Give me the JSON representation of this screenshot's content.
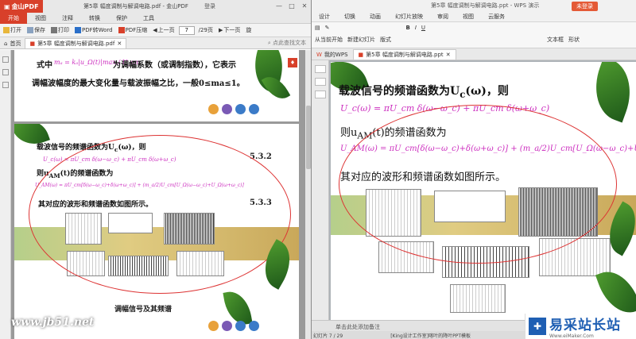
{
  "left_window": {
    "app_name": "金山PDF",
    "title": "第5章 幅度调制与解调电路.pdf - 金山PDF",
    "login": "登录",
    "menu": [
      "开始",
      "视图",
      "注释",
      "转换",
      "保护",
      "工具"
    ],
    "toolbar": {
      "open": "打开",
      "save": "保存",
      "print": "打印",
      "pdf_to_word": "PDF转Word",
      "pdf_compress": "PDF压缩",
      "prev_page": "上一页",
      "next_page": "下一页",
      "current_page": "7",
      "total_pages": "/29页",
      "rotate": "旋"
    },
    "tabs": {
      "home": "首页",
      "document": "第5章 幅度调制与解调电路.pdf"
    },
    "search_placeholder": "点此查找文本",
    "page1": {
      "line1_prefix": "式中",
      "line1_formula": "mₐ = kₐ|u_Ω(t)|max / U_cm",
      "line1_suffix": "为调幅系数（或调制指数），它表示",
      "line2": "调幅波幅度的最大变化量与载波振幅之比，一般0≤ma≤1。"
    },
    "page2": {
      "line1": "载波信号的频谱函数为U",
      "line1_sub": "c",
      "line1_tail": "(ω)，则",
      "formula1": "U_c(ω) = πU_cm δ(ω−ω_c) + πU_cm δ(ω+ω_c)",
      "eq1": "5.3.2",
      "line2_prefix": "则u",
      "line2_sub": "AM",
      "line2_tail": "(t)的频谱函数为",
      "formula2": "U_AM(ω) = πU_cm[δ(ω−ω_c)+δ(ω+ω_c)] + (m_a/2)U_cm[U_Ω(ω−ω_c)+U_Ω(ω+ω_c)]",
      "eq2": "5.3.3",
      "line3": "其对应的波形和频谱函数如图所示。",
      "figure_caption": "调幅信号及其频谱"
    },
    "watermark": "www.jb51.net"
  },
  "right_window": {
    "title": "第5章 幅度调制与解调电路.ppt - WPS 演示",
    "login_button": "未登录",
    "menu": [
      "设计",
      "切换",
      "动画",
      "幻灯片放映",
      "审阅",
      "视图",
      "云服务"
    ],
    "ribbon": {
      "from_current": "从当前开始",
      "new_slide": "新建幻灯片",
      "layout": "版式",
      "text_box": "文本框",
      "shape": "形状"
    },
    "tabs": {
      "my_wps": "我的WPS",
      "document": "第5章 幅度调制与解调电路.ppt"
    },
    "slide": {
      "line1": "载波信号的频谱函数为U",
      "line1_sub": "c",
      "line1_tail": "(ω)，则",
      "formula1": "U_c(ω) = πU_cm δ(ω−ω_c) + πU_cm δ(ω+ω_c)",
      "line2_prefix": "则u",
      "line2_sub": "AM",
      "line2_tail": "(t)的频谱函数为",
      "formula2": "U_AM(ω) = πU_cm[δ(ω−ω_c)+δ(ω+ω_c)] + (m_a/2)U_cm[U_Ω(ω−ω_c)+U",
      "line3": "其对应的波形和频谱函数如图所示。"
    },
    "notes_placeholder": "单击此处添加备注",
    "status": {
      "slide_info": "幻灯片 7 / 29",
      "template": "[King设计工作室]喀叶的降叶PPT模板"
    }
  },
  "site_logo": {
    "name": "易采站长站",
    "url": "Www.eiMaker.Com"
  }
}
